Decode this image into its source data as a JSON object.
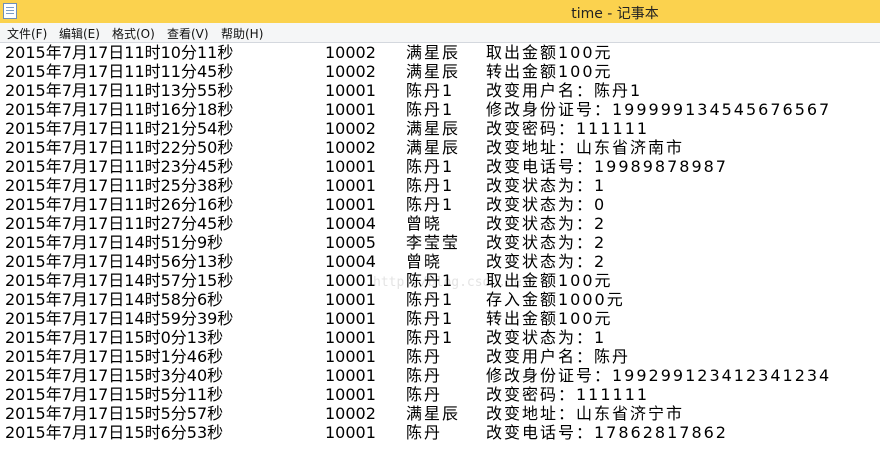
{
  "window": {
    "title": "time - 记事本"
  },
  "menu": [
    "文件(F)",
    "编辑(E)",
    "格式(O)",
    "查看(V)",
    "帮助(H)"
  ],
  "watermark": "http://blog.csdn.net/",
  "lines": [
    {
      "time": "2015年7月17日11时10分11秒",
      "id": "10002",
      "name": "满星辰",
      "action": "取出金额100元"
    },
    {
      "time": "2015年7月17日11时11分45秒",
      "id": "10002",
      "name": "满星辰",
      "action": "转出金额100元"
    },
    {
      "time": "2015年7月17日11时13分55秒",
      "id": "10001",
      "name": "陈丹1",
      "action": "改变用户名：陈丹1"
    },
    {
      "time": "2015年7月17日11时16分18秒",
      "id": "10001",
      "name": "陈丹1",
      "action": "修改身份证号：199999134545676567"
    },
    {
      "time": "2015年7月17日11时21分54秒",
      "id": "10002",
      "name": "满星辰",
      "action": "改变密码：111111"
    },
    {
      "time": "2015年7月17日11时22分50秒",
      "id": "10002",
      "name": "满星辰",
      "action": "改变地址：山东省济南市"
    },
    {
      "time": "2015年7月17日11时23分45秒",
      "id": "10001",
      "name": "陈丹1",
      "action": "改变电话号：19989878987"
    },
    {
      "time": "2015年7月17日11时25分38秒",
      "id": "10001",
      "name": "陈丹1",
      "action": "改变状态为：1"
    },
    {
      "time": "2015年7月17日11时26分16秒",
      "id": "10001",
      "name": "陈丹1",
      "action": "改变状态为：0"
    },
    {
      "time": "2015年7月17日11时27分45秒",
      "id": "10004",
      "name": "曾晓",
      "action": "改变状态为：2"
    },
    {
      "time": "2015年7月17日14时51分9秒",
      "id": "10005",
      "name": "李莹莹",
      "action": "改变状态为：2"
    },
    {
      "time": "2015年7月17日14时56分13秒",
      "id": "10004",
      "name": "曾晓",
      "action": "改变状态为：2"
    },
    {
      "time": "2015年7月17日14时57分15秒",
      "id": "10001",
      "name": "陈丹1",
      "action": "取出金额100元"
    },
    {
      "time": "2015年7月17日14时58分6秒",
      "id": "10001",
      "name": "陈丹1",
      "action": "存入金额1000元"
    },
    {
      "time": "2015年7月17日14时59分39秒",
      "id": "10001",
      "name": "陈丹1",
      "action": "转出金额100元"
    },
    {
      "time": "2015年7月17日15时0分13秒",
      "id": "10001",
      "name": "陈丹1",
      "action": "改变状态为：1"
    },
    {
      "time": "2015年7月17日15时1分46秒",
      "id": "10001",
      "name": "陈丹",
      "action": "改变用户名：陈丹"
    },
    {
      "time": "2015年7月17日15时3分40秒",
      "id": "10001",
      "name": "陈丹",
      "action": "修改身份证号：199299123412341234"
    },
    {
      "time": "2015年7月17日15时5分11秒",
      "id": "10001",
      "name": "陈丹",
      "action": "改变密码：111111"
    },
    {
      "time": "2015年7月17日15时5分57秒",
      "id": "10002",
      "name": "满星辰",
      "action": "改变地址：山东省济宁市"
    },
    {
      "time": "2015年7月17日15时6分53秒",
      "id": "10001",
      "name": "陈丹",
      "action": "改变电话号：17862817862"
    }
  ]
}
